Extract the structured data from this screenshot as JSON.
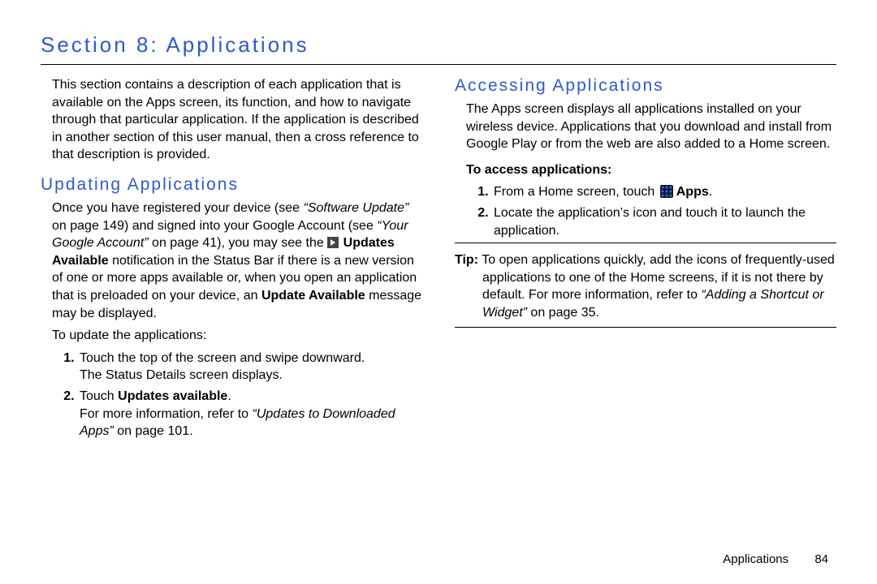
{
  "title": "Section 8: Applications",
  "intro": "This section contains a description of each application that is available on the Apps screen, its function, and how to navigate through that particular application. If the application is described in another section of this user manual, then a cross reference to that description is provided.",
  "left": {
    "heading": "Updating Applications",
    "p1a": "Once you have registered your device (see ",
    "p1_ref1": "“Software Update”",
    "p1b": " on page 149) and signed into your Google Account (see ",
    "p1_ref2": "“Your Google Account”",
    "p1c": " on page 41), you may see the ",
    "p1_bold1": "Updates Available",
    "p1d": " notification in the Status Bar if there is a new version of one or more apps available or, when you open an application that is preloaded on your device, an ",
    "p1_bold2": "Update Available",
    "p1e": " message may be displayed.",
    "lead": "To update the applications:",
    "step1a": "Touch the top of the screen and swipe downward.",
    "step1b": "The Status Details screen displays.",
    "step2a": "Touch ",
    "step2a_bold": "Updates available",
    "step2a_end": ".",
    "step2b_pre": "For more information, refer to ",
    "step2b_ref": "“Updates to Downloaded Apps”",
    "step2b_post": " on page 101."
  },
  "right": {
    "heading": "Accessing Applications",
    "p1": "The Apps screen displays all applications installed on your wireless device. Applications that you download and install from Google Play or from the web are also added to a Home screen.",
    "access_label": "To access applications:",
    "step1_pre": "From a Home screen, touch ",
    "step1_bold": "Apps",
    "step1_post": ".",
    "step2": "Locate the application’s icon and touch it to launch the application.",
    "tip_label": "Tip:",
    "tip_body_a": " To open applications quickly, add the icons of frequently-used applications to one of the Home screens, if it is not there by default. For more information, refer to ",
    "tip_ref": "“Adding a Shortcut or Widget”",
    "tip_body_b": " on page 35."
  },
  "footer": {
    "section": "Applications",
    "page": "84"
  }
}
